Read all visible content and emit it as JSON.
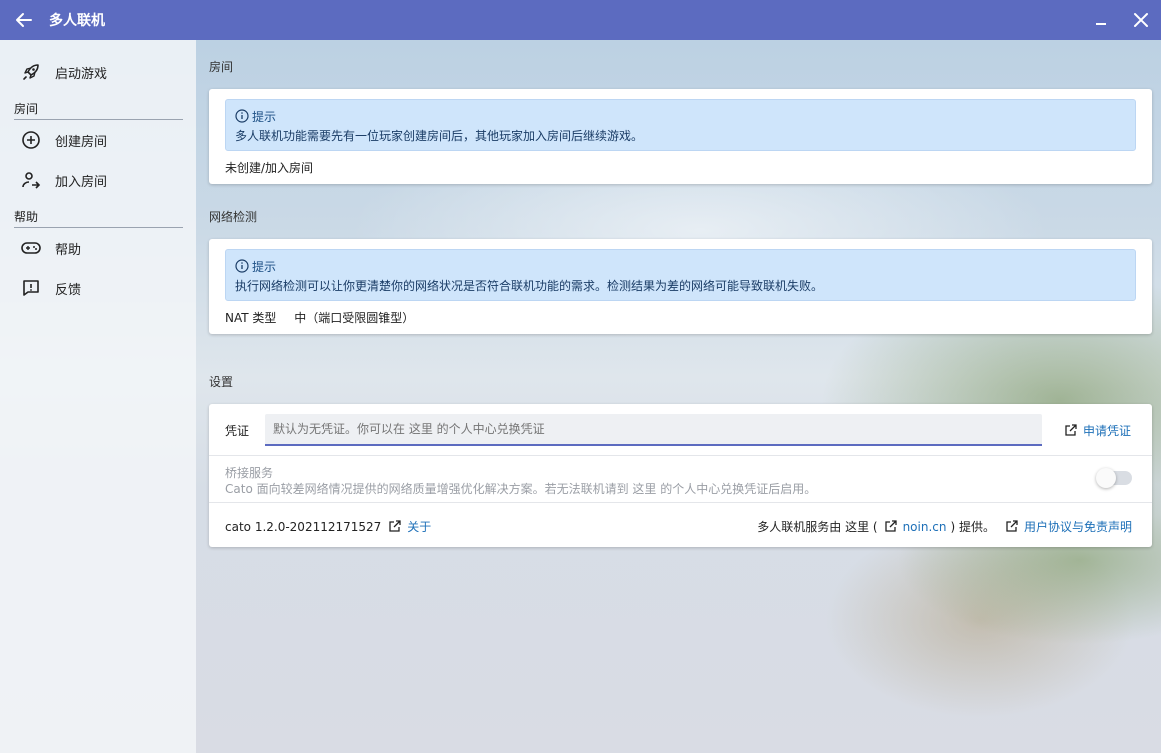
{
  "window": {
    "title": "多人联机"
  },
  "sidebar": {
    "items": [
      {
        "label": "启动游戏",
        "icon": "rocket-icon"
      }
    ],
    "groups": [
      {
        "title": "房间",
        "items": [
          {
            "label": "创建房间",
            "icon": "plus-circle-icon"
          },
          {
            "label": "加入房间",
            "icon": "person-join-icon"
          }
        ]
      },
      {
        "title": "帮助",
        "items": [
          {
            "label": "帮助",
            "icon": "gamepad-icon"
          },
          {
            "label": "反馈",
            "icon": "feedback-icon"
          }
        ]
      }
    ]
  },
  "room": {
    "section_title": "房间",
    "hint_title": "提示",
    "hint_text": "多人联机功能需要先有一位玩家创建房间后，其他玩家加入房间后继续游戏。",
    "status": "未创建/加入房间"
  },
  "network": {
    "section_title": "网络检测",
    "hint_title": "提示",
    "hint_text": "执行网络检测可以让你更清楚你的网络状况是否符合联机功能的需求。检测结果为差的网络可能导致联机失败。",
    "nat_label": "NAT 类型",
    "nat_value": "中（端口受限圆锥型）"
  },
  "settings": {
    "section_title": "设置",
    "credential_label": "凭证",
    "credential_placeholder": "默认为无凭证。你可以在 这里 的个人中心兑换凭证",
    "apply_link": "申请凭证",
    "bridge_title": "桥接服务",
    "bridge_desc": "Cato 面向较差网络情况提供的网络质量增强优化解决方案。若无法联机请到 这里 的个人中心兑换凭证后启用。",
    "bridge_enabled": false,
    "version": "cato 1.2.0-202112171527",
    "about_link": "关于",
    "provider_prefix": "多人联机服务由 这里 (",
    "provider_link": "noin.cn",
    "provider_suffix": ") 提供。",
    "terms_link": "用户协议与免责声明"
  },
  "colors": {
    "accent": "#5c6bc0",
    "hint_bg": "#cfe5fb",
    "link": "#1e70b8"
  }
}
